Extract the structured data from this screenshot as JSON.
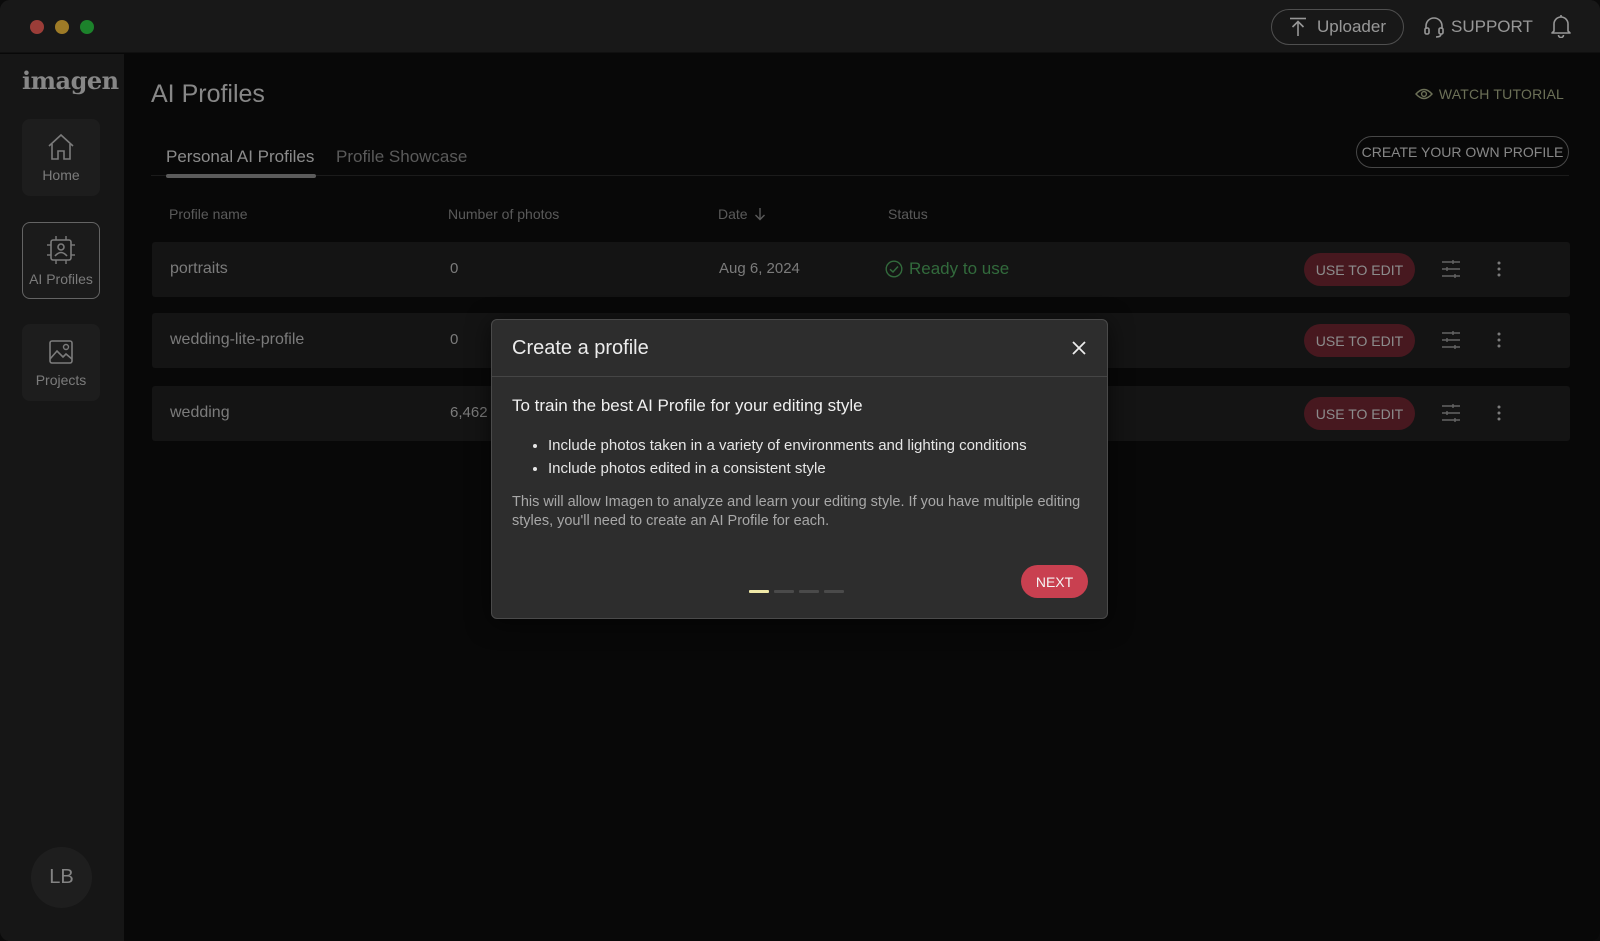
{
  "titlebar": {
    "uploader_label": "Uploader",
    "support_label": "SUPPORT"
  },
  "sidebar": {
    "logo": "imagen",
    "items": [
      {
        "label": "Home",
        "icon": "home-icon"
      },
      {
        "label": "AI Profiles",
        "icon": "ai-profiles-icon",
        "active": true
      },
      {
        "label": "Projects",
        "icon": "projects-icon"
      }
    ],
    "avatar_initials": "LB"
  },
  "main": {
    "title": "AI Profiles",
    "watch_tutorial": "WATCH TUTORIAL",
    "create_own_profile": "CREATE YOUR OWN PROFILE",
    "tabs": [
      {
        "label": "Personal AI Profiles",
        "active": true
      },
      {
        "label": "Profile Showcase",
        "active": false
      }
    ],
    "table": {
      "headers": {
        "profile_name": "Profile name",
        "number_of_photos": "Number of photos",
        "date": "Date",
        "status": "Status"
      },
      "rows": [
        {
          "name": "portraits",
          "photos": "0",
          "date": "Aug 6, 2024",
          "status": "Ready to use",
          "action": "USE TO EDIT"
        },
        {
          "name": "wedding-lite-profile",
          "photos": "0",
          "date": "",
          "status": "",
          "action": "USE TO EDIT"
        },
        {
          "name": "wedding",
          "photos": "6,462",
          "date": "",
          "status": "",
          "action": "USE TO EDIT"
        }
      ]
    }
  },
  "modal": {
    "title": "Create a profile",
    "heading": "To train the best AI Profile for your editing style",
    "bullets": [
      "Include photos taken in a variety of environments and lighting conditions",
      "Include photos edited in a consistent style"
    ],
    "body": "This will allow Imagen to analyze and learn your editing style. If you have multiple editing styles, you'll need to create an AI Profile for each.",
    "next_label": "NEXT",
    "step_current": 1,
    "step_total": 4
  },
  "colors": {
    "accent_red": "#c94050",
    "use_edit_bg": "#6e2631",
    "ready_green": "#4da35c",
    "tutorial_olive": "#a6ad86"
  }
}
